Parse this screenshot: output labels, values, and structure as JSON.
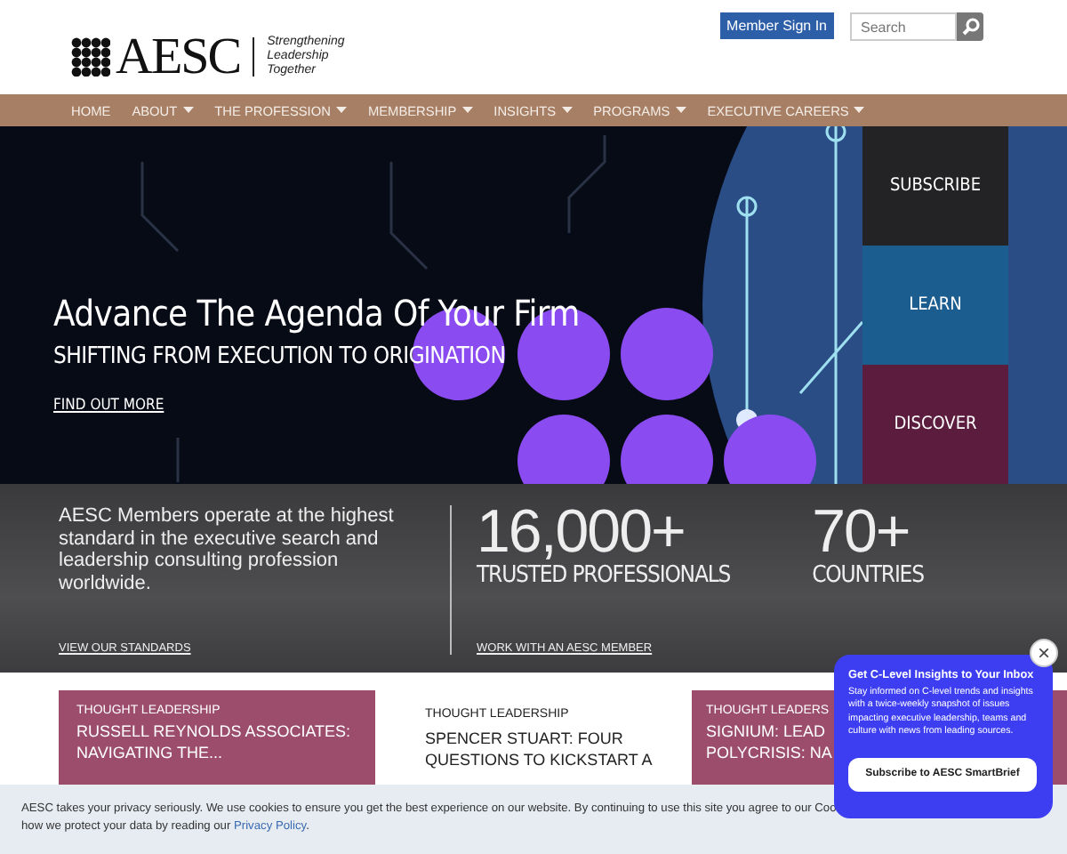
{
  "header": {
    "logo_text": "AESC",
    "tagline": [
      "Strengthening",
      "Leadership",
      "Together"
    ],
    "sign_in": "Member Sign In",
    "search": {
      "placeholder": "Search"
    }
  },
  "nav": [
    {
      "label": "HOME",
      "dropdown": false
    },
    {
      "label": "ABOUT",
      "dropdown": true
    },
    {
      "label": "THE PROFESSION",
      "dropdown": true
    },
    {
      "label": "MEMBERSHIP",
      "dropdown": true
    },
    {
      "label": "INSIGHTS",
      "dropdown": true
    },
    {
      "label": "PROGRAMS",
      "dropdown": true
    },
    {
      "label": "EXECUTIVE CAREERS",
      "dropdown": true
    }
  ],
  "hero": {
    "kind": "picture",
    "title": "Advance The Agenda Of Your Firm",
    "subtitle": "SHIFTING FROM EXECUTION TO ORIGINATION",
    "link": "FIND OUT MORE",
    "tiles": [
      {
        "label": "SUBSCRIBE",
        "color": "#232325"
      },
      {
        "label": "LEARN",
        "color": "#1b5d8f"
      },
      {
        "label": "DISCOVER",
        "color": "#5b1c3e"
      }
    ]
  },
  "stats": {
    "intro": "AESC Members operate at the highest standard in the executive search and leadership consulting profession worldwide.",
    "intro_link": "VIEW OUR STANDARDS",
    "items": [
      {
        "value": "16,000+",
        "label": "TRUSTED PROFESSIONALS"
      },
      {
        "value": "70+",
        "label": "COUNTRIES"
      }
    ],
    "link": "WORK WITH AN AESC MEMBER"
  },
  "cards": [
    {
      "category": "THOUGHT LEADERSHIP",
      "title": "RUSSELL REYNOLDS ASSOCIATES: NAVIGATING THE..."
    },
    {
      "kind": "plain",
      "category": "THOUGHT LEADERSHIP",
      "title": "SPENCER STUART: FOUR QUESTIONS TO KICKSTART A"
    },
    {
      "category": "THOUGHT LEADERS",
      "title": "SIGNIUM: LEAD\nPOLYCRISIS: NA"
    }
  ],
  "cookie": {
    "line_1": "AESC takes your privacy seriously. We use cookies to ensure you get the best experience on our website. By continuing to use this site you agree to our Coo",
    "line_2": "how we protect your data by reading our",
    "link": "Privacy Policy",
    "line_2_end": "."
  },
  "popup": {
    "title": "Get C-Level Insights to Your Inbox",
    "text": "Stay informed on C-level trends and insights with a twice-weekly snapshot of issues impacting executive leadership, teams and culture with news from leading sources.",
    "button": "Subscribe to AESC SmartBrief",
    "close": "×"
  }
}
